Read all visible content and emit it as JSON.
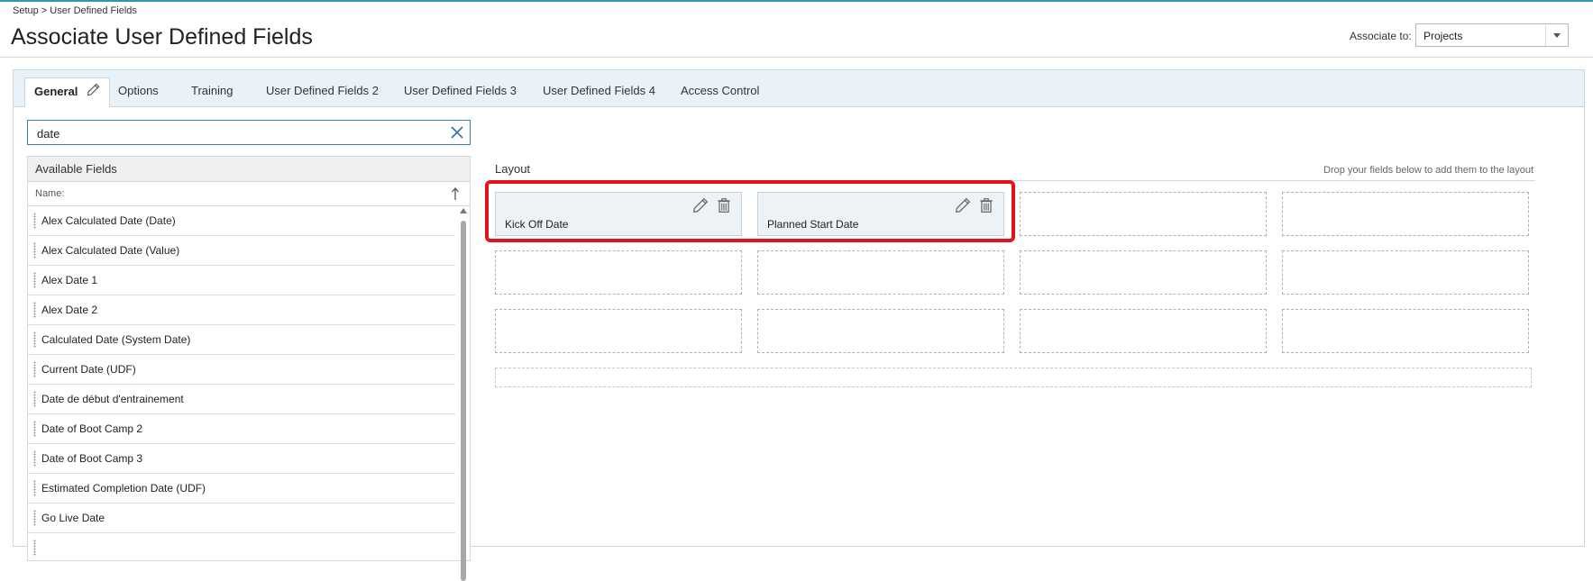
{
  "breadcrumb": {
    "setup": "Setup",
    "separator": " > ",
    "current": "User Defined Fields"
  },
  "page": {
    "title": "Associate User Defined Fields"
  },
  "associate": {
    "label": "Associate to:",
    "value": "Projects"
  },
  "tabs": [
    {
      "label": "General",
      "active": true
    },
    {
      "label": "Options"
    },
    {
      "label": "Training"
    },
    {
      "label": "User Defined Fields 2"
    },
    {
      "label": "User Defined Fields 3"
    },
    {
      "label": "User Defined Fields 4"
    },
    {
      "label": "Access Control"
    }
  ],
  "search": {
    "value": "date"
  },
  "fields": {
    "header": "Available Fields",
    "column": "Name:",
    "items": [
      "Alex Calculated Date (Date)",
      "Alex Calculated Date (Value)",
      "Alex Date 1",
      "Alex Date 2",
      "Calculated Date (System Date)",
      "Current Date (UDF)",
      "Date de début d'entrainement",
      "Date of Boot Camp 2",
      "Date of Boot Camp 3",
      "Estimated Completion Date (UDF)",
      "Go Live Date"
    ]
  },
  "layout": {
    "title": "Layout",
    "hint": "Drop your fields below to add them to the layout",
    "placed": [
      "Kick Off Date",
      "Planned Start Date"
    ]
  },
  "colors": {
    "accent": "#2a9bb0",
    "highlight": "#e3131b",
    "slot_border": "#9fb5cf",
    "focus": "#3c7fb5"
  },
  "icons": {
    "tab_edit": "pencil-icon",
    "clear": "close-icon",
    "sort": "sort-arrow-icon",
    "card_edit": "pencil-icon",
    "card_delete": "trash-icon",
    "dropdown": "chevron-down-icon"
  }
}
